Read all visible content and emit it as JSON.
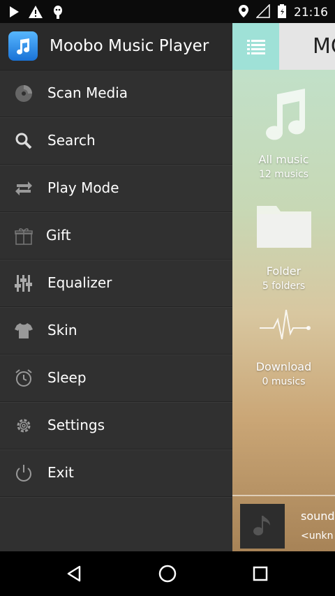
{
  "status_bar": {
    "time": "21:16",
    "left_icons": [
      "play-icon",
      "warning-icon",
      "android-icon"
    ],
    "right_icons": [
      "location-icon",
      "signal-icon",
      "battery-icon"
    ]
  },
  "drawer": {
    "app_name": "Moobo Music Player",
    "items": [
      {
        "label": "Scan Media",
        "icon": "disc-icon"
      },
      {
        "label": "Search",
        "icon": "search-icon"
      },
      {
        "label": "Play Mode",
        "icon": "repeat-icon"
      },
      {
        "label": "Gift",
        "icon": "gift-icon"
      },
      {
        "label": "Equalizer",
        "icon": "equalizer-icon"
      },
      {
        "label": "Skin",
        "icon": "shirt-icon"
      },
      {
        "label": "Sleep",
        "icon": "alarm-icon"
      },
      {
        "label": "Settings",
        "icon": "gear-icon"
      },
      {
        "label": "Exit",
        "icon": "power-icon"
      }
    ]
  },
  "main": {
    "title_partial": "MC",
    "tiles": [
      {
        "name": "All music",
        "count": "12 musics",
        "icon": "music-note-icon"
      },
      {
        "name": "Folder",
        "count": "5 folders",
        "icon": "folder-icon"
      },
      {
        "name": "Download",
        "count": "0 musics",
        "icon": "pulse-icon"
      }
    ],
    "mini_player": {
      "title": "sound",
      "artist": "<unkn"
    }
  },
  "nav_bar": {
    "buttons": [
      "back-icon",
      "home-icon",
      "recents-icon"
    ]
  },
  "colors": {
    "drawer_bg": "#303030",
    "drawer_header_bg": "#2a2a2a",
    "menu_button_bg": "#9fe1d7",
    "app_icon_blue": "#2a8ae8"
  }
}
